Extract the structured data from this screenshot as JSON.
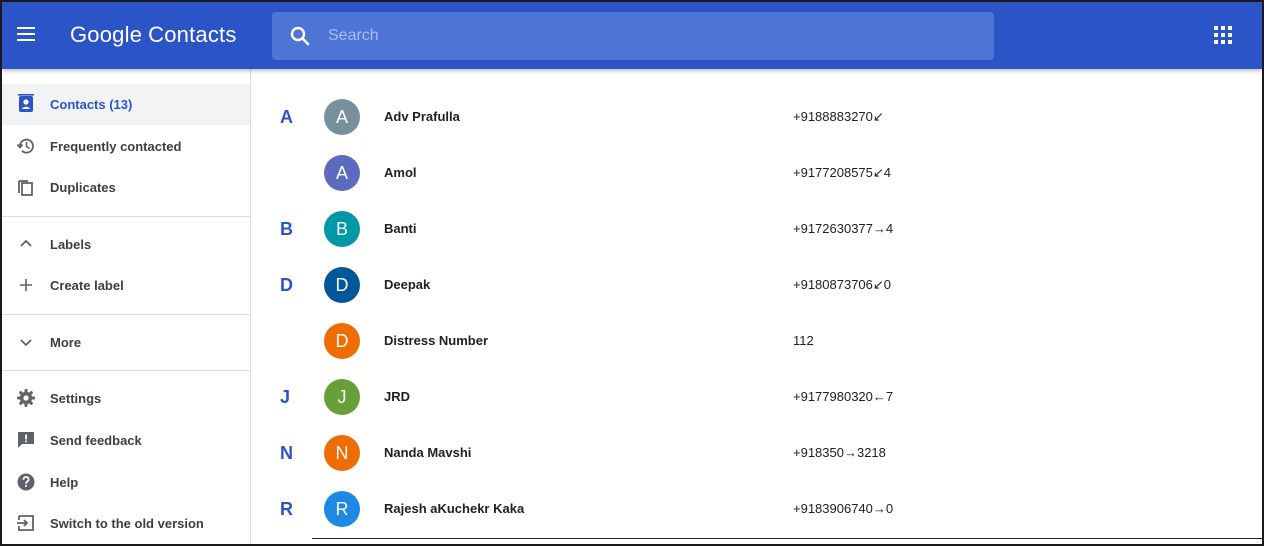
{
  "app": {
    "logo_google": "Google",
    "logo_product": "Contacts"
  },
  "search": {
    "placeholder": "Search"
  },
  "sidebar": {
    "items": [
      {
        "label": "Contacts (13)",
        "icon": "person-card-icon",
        "active": true
      },
      {
        "label": "Frequently contacted",
        "icon": "history-icon"
      },
      {
        "label": "Duplicates",
        "icon": "copy-icon"
      },
      {
        "label": "Labels",
        "icon": "chevron-up-icon"
      },
      {
        "label": "Create label",
        "icon": "plus-icon"
      },
      {
        "label": "More",
        "icon": "chevron-down-icon"
      },
      {
        "label": "Settings",
        "icon": "gear-icon"
      },
      {
        "label": "Send feedback",
        "icon": "feedback-icon"
      },
      {
        "label": "Help",
        "icon": "help-icon"
      },
      {
        "label": "Switch to the old version",
        "icon": "exit-icon"
      }
    ]
  },
  "contacts": [
    {
      "letter": "A",
      "initial": "A",
      "name": "Adv Prafulla",
      "phone": "+9188883270↙",
      "color": "#78909c"
    },
    {
      "letter": "",
      "initial": "A",
      "name": "Amol",
      "phone": "+9177208575↙4",
      "color": "#5c6bc0"
    },
    {
      "letter": "B",
      "initial": "B",
      "name": "Banti",
      "phone": "+9172630377→4",
      "color": "#0097a7"
    },
    {
      "letter": "D",
      "initial": "D",
      "name": "Deepak",
      "phone": "+9180873706↙0",
      "color": "#01579b"
    },
    {
      "letter": "",
      "initial": "D",
      "name": "Distress Number",
      "phone": "112",
      "color": "#ef6c00"
    },
    {
      "letter": "J",
      "initial": "J",
      "name": "JRD",
      "phone": "+9177980320←7",
      "color": "#689f38"
    },
    {
      "letter": "N",
      "initial": "N",
      "name": "Nanda Mavshi",
      "phone": "+918350→3218",
      "color": "#ef6c00"
    },
    {
      "letter": "R",
      "initial": "R",
      "name": "Rajesh aKuchekr Kaka",
      "phone": "+9183906740→0",
      "color": "#1e88e5"
    }
  ],
  "colors": {
    "header": "#2b54c7",
    "search_bg": "#4e74d6",
    "accent": "#2b54c7"
  }
}
